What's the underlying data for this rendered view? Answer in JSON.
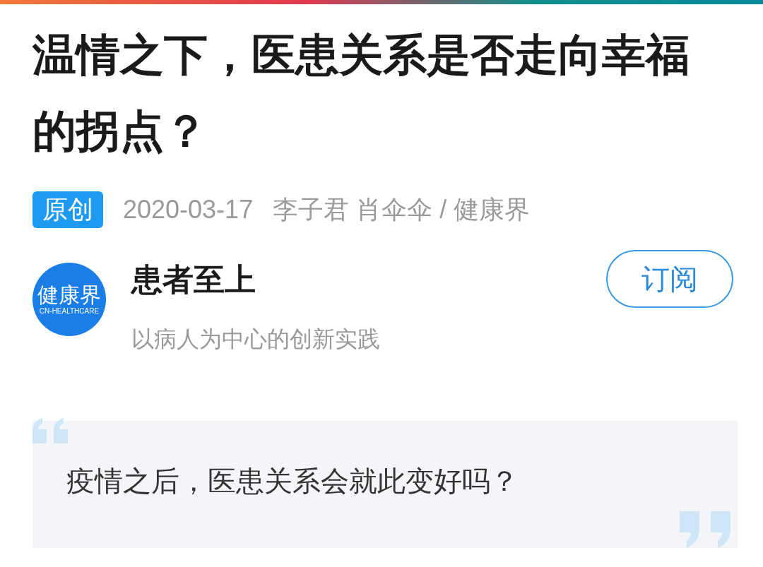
{
  "article": {
    "title": "温情之下，医患关系是否走向幸福的拐点？",
    "badge": "原创",
    "date": "2020-03-17",
    "authors": "李子君 肖伞伞 / 健康界"
  },
  "channel": {
    "logo_text": "健康界",
    "logo_subtext": "CN-HEALTHCARE",
    "name": "患者至上",
    "description": "以病人为中心的创新实践",
    "subscribe": "订阅"
  },
  "quote": {
    "text": "疫情之后，医患关系会就此变好吗？"
  }
}
